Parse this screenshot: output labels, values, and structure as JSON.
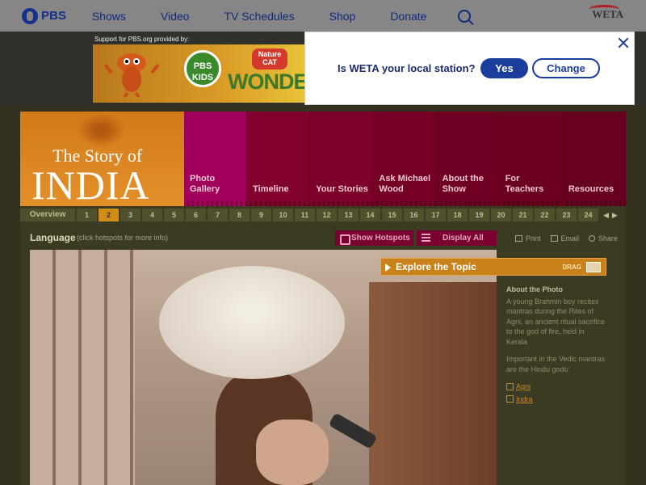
{
  "topnav": {
    "logo_text": "PBS",
    "links": [
      "Shows",
      "Video",
      "TV Schedules",
      "Shop",
      "Donate"
    ],
    "station": "WETA"
  },
  "ad": {
    "label": "Support for PBS.org provided by:",
    "badge_text": "PBS KIDS",
    "naturecat_text": "Nature CAT",
    "wonder_text": "WONDE"
  },
  "popup": {
    "question": "Is WETA your local station?",
    "yes_label": "Yes",
    "change_label": "Change"
  },
  "site": {
    "logo_line1": "The Story of",
    "logo_line2": "INDIA",
    "tabs": [
      "Photo Gallery",
      "Timeline",
      "Your Stories",
      "Ask Michael Wood",
      "About the Show",
      "For Teachers",
      "Resources"
    ],
    "active_tab": "Photo Gallery"
  },
  "pager": {
    "overview": "Overview",
    "pages": [
      "1",
      "2",
      "3",
      "4",
      "5",
      "6",
      "7",
      "8",
      "9",
      "10",
      "11",
      "12",
      "13",
      "14",
      "15",
      "16",
      "17",
      "18",
      "19",
      "20",
      "21",
      "22",
      "23",
      "24"
    ],
    "current": "2",
    "prev_glyph": "◀",
    "next_glyph": "▶"
  },
  "gallery": {
    "title": "Language",
    "note": "(click hotspots for more info)",
    "show_hotspots": "Show Hotspots",
    "display_all": "Display All",
    "print": "Print",
    "email": "Email",
    "share": "Share"
  },
  "explore": {
    "label": "Explore the Topic",
    "drag": "DRAG"
  },
  "about": {
    "heading": "About the Photo",
    "desc": "A young Brahmin boy recites mantras during the Rites of Agni, an ancient ritual sacrifice to the god of fire, held in Kerala",
    "vedic": "Important in the Vedic mantras are the Hindu gods:",
    "links": [
      "Agni",
      "Indra"
    ]
  }
}
